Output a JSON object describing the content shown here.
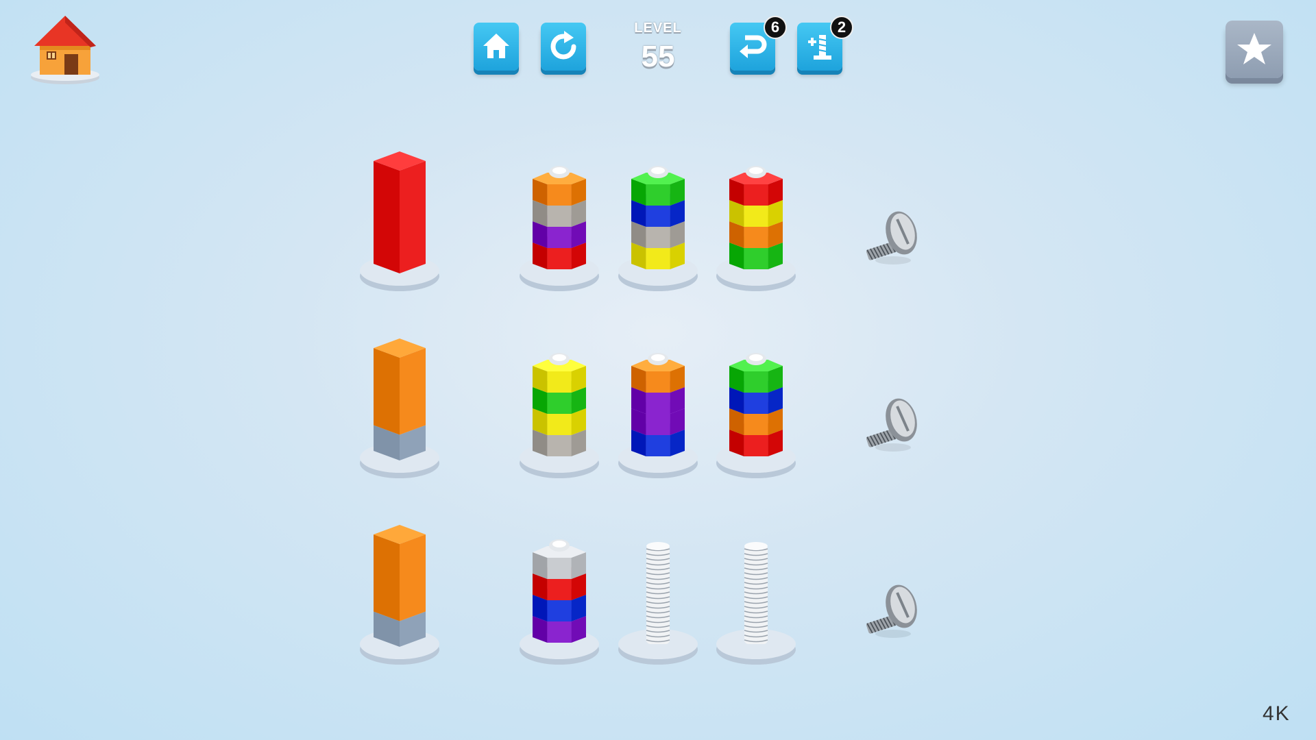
{
  "hud": {
    "level_label": "LEVEL",
    "level_number": "55",
    "undo_count": "6",
    "add_bolt_count": "2",
    "icons": {
      "home_corner": "house-icon",
      "home_button": "home-icon",
      "restart": "restart-icon",
      "undo": "undo-icon",
      "add_bolt": "add-bolt-icon",
      "star": "star-icon"
    }
  },
  "watermark": "4K",
  "colors": {
    "red": "#ec1f1f",
    "orange": "#f68a1c",
    "gray": "#b8b4ae",
    "purple": "#8a24cf",
    "green": "#2fce2c",
    "blue": "#1f3fe0",
    "yellow": "#f2ea1a",
    "silver": "#c9ccd0",
    "target_base": "#8fa2b8"
  },
  "board": {
    "rows": [
      {
        "target": {
          "top_color": "red",
          "bottom_color": "red",
          "fill": 1.0
        },
        "bolts": [
          {
            "nuts_top_to_bottom": [
              "orange",
              "gray",
              "purple",
              "red"
            ]
          },
          {
            "nuts_top_to_bottom": [
              "green",
              "blue",
              "gray",
              "yellow"
            ]
          },
          {
            "nuts_top_to_bottom": [
              "red",
              "yellow",
              "orange",
              "green"
            ]
          }
        ],
        "loose_screw": "screw-icon"
      },
      {
        "target": {
          "top_color": "orange",
          "bottom_color": "target_base",
          "fill": 0.75
        },
        "bolts": [
          {
            "nuts_top_to_bottom": [
              "yellow",
              "green",
              "yellow",
              "gray"
            ]
          },
          {
            "nuts_top_to_bottom": [
              "orange",
              "purple",
              "purple",
              "blue"
            ]
          },
          {
            "nuts_top_to_bottom": [
              "green",
              "blue",
              "orange",
              "red"
            ]
          }
        ],
        "loose_screw": "screw-icon"
      },
      {
        "target": {
          "top_color": "orange",
          "bottom_color": "target_base",
          "fill": 0.75
        },
        "bolts": [
          {
            "nuts_top_to_bottom": [
              "silver",
              "red",
              "blue",
              "purple"
            ]
          },
          {
            "nuts_top_to_bottom": []
          },
          {
            "nuts_top_to_bottom": []
          }
        ],
        "loose_screw": "screw-icon"
      }
    ]
  }
}
